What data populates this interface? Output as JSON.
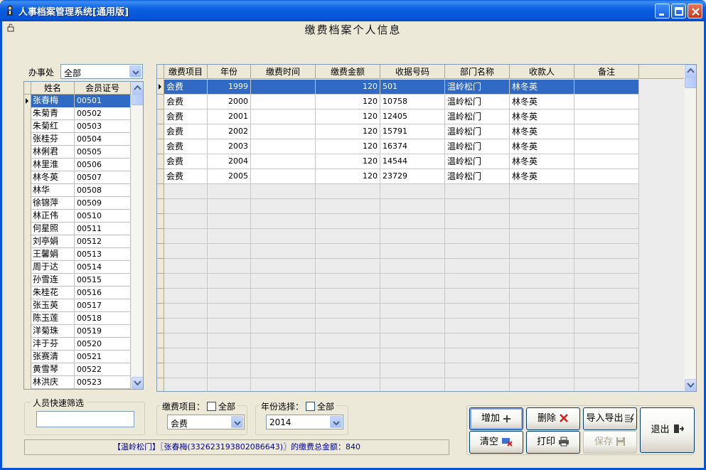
{
  "window": {
    "title": "人事档案管理系统[通用版]"
  },
  "form": {
    "title": "缴费档案个人信息"
  },
  "filters": {
    "office_label": "办事处",
    "office_value": "全部",
    "quick_filter_label": "人员快速筛选",
    "quick_filter_value": "",
    "fee_item_label": "缴费项目：",
    "fee_item_all_label": "全部",
    "fee_item_value": "会费",
    "year_label": "年份选择：",
    "year_all_label": "全部",
    "year_value": "2014"
  },
  "member_list": {
    "columns": [
      "姓名",
      "会员证号"
    ],
    "rows": [
      [
        "张春梅",
        "00501"
      ],
      [
        "朱菊青",
        "00502"
      ],
      [
        "朱菊红",
        "00503"
      ],
      [
        "张桂芬",
        "00504"
      ],
      [
        "林俐君",
        "00505"
      ],
      [
        "林里淮",
        "00506"
      ],
      [
        "林冬英",
        "00507"
      ],
      [
        "林华",
        "00508"
      ],
      [
        "徐锦萍",
        "00509"
      ],
      [
        "林正伟",
        "00510"
      ],
      [
        "何星照",
        "00511"
      ],
      [
        "刘亭娟",
        "00512"
      ],
      [
        "王馨娟",
        "00513"
      ],
      [
        "周于达",
        "00514"
      ],
      [
        "孙雪连",
        "00515"
      ],
      [
        "朱桂花",
        "00516"
      ],
      [
        "张玉英",
        "00517"
      ],
      [
        "陈玉莲",
        "00518"
      ],
      [
        "洋菊珠",
        "00519"
      ],
      [
        "沣于芬",
        "00520"
      ],
      [
        "张赛清",
        "00521"
      ],
      [
        "黄雪琴",
        "00522"
      ],
      [
        "林洪庆",
        "00523"
      ]
    ]
  },
  "fee_table": {
    "columns": [
      "缴费项目",
      "年份",
      "缴费时间",
      "缴费金额",
      "收据号码",
      "部门名称",
      "收款人",
      "备注"
    ],
    "rows": [
      [
        "会费",
        "1999",
        "",
        "120",
        "501",
        "温岭松门",
        "林冬英",
        ""
      ],
      [
        "会费",
        "2000",
        "",
        "120",
        "10758",
        "温岭松门",
        "林冬英",
        ""
      ],
      [
        "会费",
        "2001",
        "",
        "120",
        "12405",
        "温岭松门",
        "林冬英",
        ""
      ],
      [
        "会费",
        "2002",
        "",
        "120",
        "15791",
        "温岭松门",
        "林冬英",
        ""
      ],
      [
        "会费",
        "2003",
        "",
        "120",
        "16374",
        "温岭松门",
        "林冬英",
        ""
      ],
      [
        "会费",
        "2004",
        "",
        "120",
        "14544",
        "温岭松门",
        "林冬英",
        ""
      ],
      [
        "会费",
        "2005",
        "",
        "120",
        "23729",
        "温岭松门",
        "林冬英",
        ""
      ]
    ]
  },
  "buttons": {
    "add": "增加",
    "delete": "删除",
    "import_export": "导入导出",
    "clear": "清空",
    "print": "打印",
    "save": "保存",
    "exit": "退出"
  },
  "status": {
    "text": "【温岭松门】〖张春梅(332623193802086643)〗的缴费总金额：840"
  }
}
